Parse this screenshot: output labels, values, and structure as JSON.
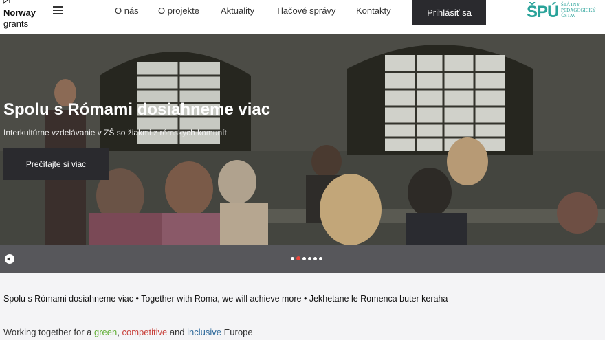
{
  "brand": {
    "name_line1": "Norway",
    "name_line2": "grants"
  },
  "nav": {
    "items": [
      {
        "label": "O nás"
      },
      {
        "label": "O projekte"
      },
      {
        "label": "Aktuality"
      },
      {
        "label": "Tlačové správy"
      },
      {
        "label": "Kontakty"
      }
    ],
    "login_label": "Prihlásiť sa"
  },
  "partner_logo": {
    "mark": "ŠPÚ",
    "line1": "ŠTÁTNY",
    "line2": "PEDAGOGICKÝ",
    "line3": "ÚSTAV",
    "color": "#2aa39a"
  },
  "hero": {
    "title": "Spolu s Rómami dosiahneme viac",
    "subtitle": "Interkultúrne vzdelávanie v ZŠ so žiakmi z rómskych komunít",
    "button_label": "Prečítajte si viac"
  },
  "slider": {
    "slide_count": 6,
    "active_index": 1,
    "accent": "#e8443a"
  },
  "content": {
    "tagline": "Spolu s Rómami dosiahneme viac • Together with Roma, we will achieve more • Jekhetane le Romenca buter keraha",
    "together": {
      "prefix": "Working together for a ",
      "green": "green",
      "sep1": ", ",
      "competitive": "competitive",
      "sep2": " and ",
      "inclusive": "inclusive",
      "suffix": " Europe"
    }
  },
  "colors": {
    "dark_button": "#2a2a2e",
    "green": "#5fae34",
    "red": "#c8413b",
    "blue": "#2f6a9b"
  }
}
